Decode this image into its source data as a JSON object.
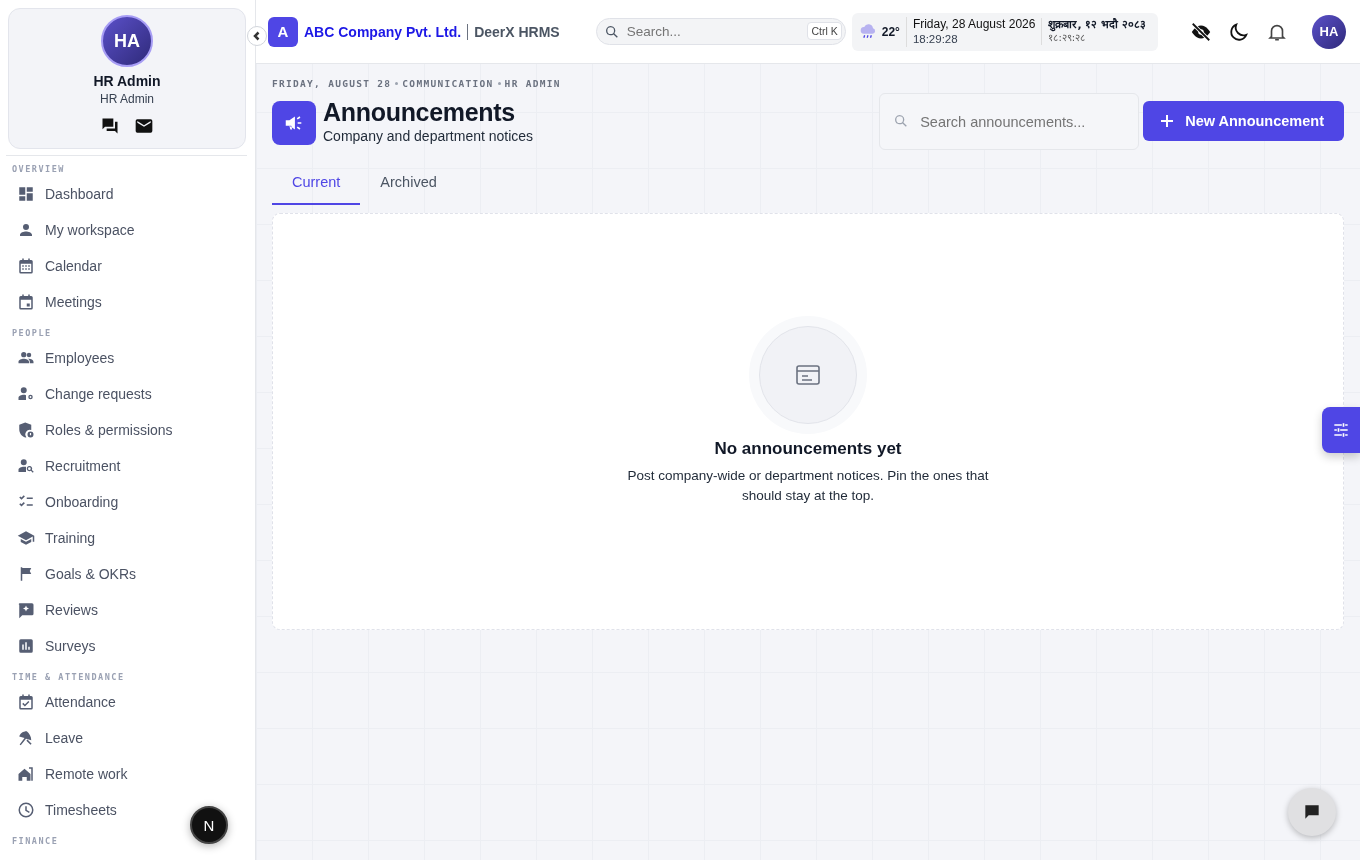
{
  "sidebar": {
    "profile": {
      "initials": "HA",
      "name": "HR Admin",
      "role": "HR Admin"
    },
    "sections": [
      {
        "label": "OVERVIEW",
        "items": [
          {
            "label": "Dashboard",
            "selected": false
          },
          {
            "label": "My workspace",
            "selected": false
          },
          {
            "label": "Calendar",
            "selected": false
          },
          {
            "label": "Meetings",
            "selected": false
          }
        ]
      },
      {
        "label": "PEOPLE",
        "items": [
          {
            "label": "Employees",
            "selected": false
          },
          {
            "label": "Change requests",
            "selected": false
          },
          {
            "label": "Roles & permissions",
            "selected": false
          },
          {
            "label": "Recruitment",
            "selected": false
          },
          {
            "label": "Onboarding",
            "selected": false
          },
          {
            "label": "Training",
            "selected": false
          },
          {
            "label": "Goals & OKRs",
            "selected": false
          },
          {
            "label": "Reviews",
            "selected": false
          },
          {
            "label": "Surveys",
            "selected": false
          }
        ]
      },
      {
        "label": "TIME & ATTENDANCE",
        "items": [
          {
            "label": "Attendance",
            "selected": false
          },
          {
            "label": "Leave",
            "selected": false
          },
          {
            "label": "Remote work",
            "selected": false
          },
          {
            "label": "Timesheets",
            "selected": false
          }
        ]
      },
      {
        "label": "FINANCE"
      }
    ],
    "dev_badge": "N"
  },
  "topbar": {
    "logo_letter": "A",
    "company": "ABC Company Pvt. Ltd.",
    "product": "DeerX HRMS",
    "search": {
      "placeholder": "Search...",
      "shortcut": "Ctrl K"
    },
    "weather": "22°",
    "date": "Friday, 28 August 2026",
    "time": "18:29:28",
    "local_date": "शुक्रबार, १२ भदौ २०८३",
    "local_time": "१८:२९:२८",
    "avatar": "HA"
  },
  "page": {
    "breadcrumb": [
      "FRIDAY, AUGUST 28",
      "COMMUNICATION",
      "HR ADMIN"
    ],
    "title": "Announcements",
    "subtitle": "Company and department notices",
    "search": {
      "placeholder": "Search announcements..."
    },
    "new_button": "New Announcement",
    "tabs": [
      {
        "label": "Current",
        "selected": true
      },
      {
        "label": "Archived",
        "selected": false
      }
    ],
    "empty": {
      "title": "No announcements yet",
      "message": "Post company-wide or department notices. Pin the ones that should stay at the top."
    }
  }
}
